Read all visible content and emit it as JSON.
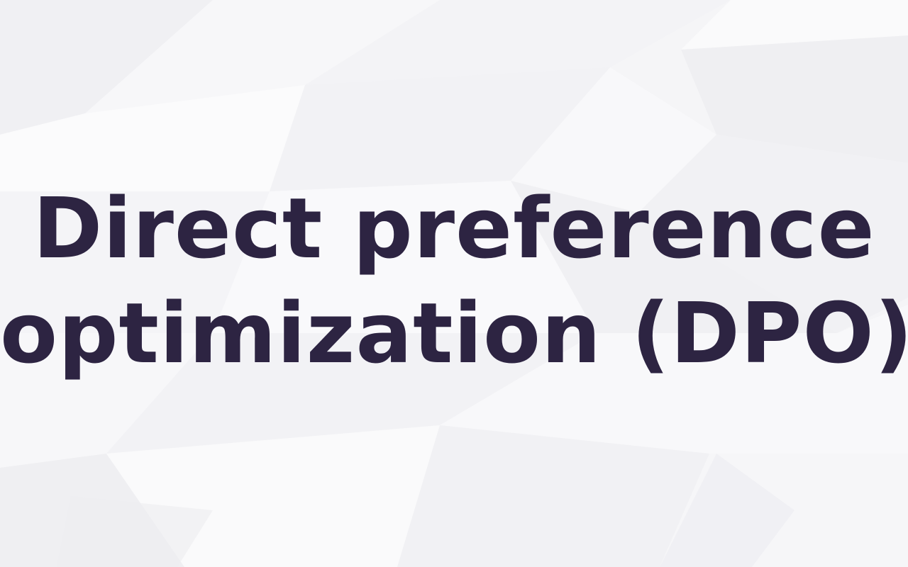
{
  "title": {
    "line1": "Direct preference",
    "line2": "optimization (DPO)"
  },
  "colors": {
    "background": "#f5f5f7",
    "text": "#2d2442"
  }
}
